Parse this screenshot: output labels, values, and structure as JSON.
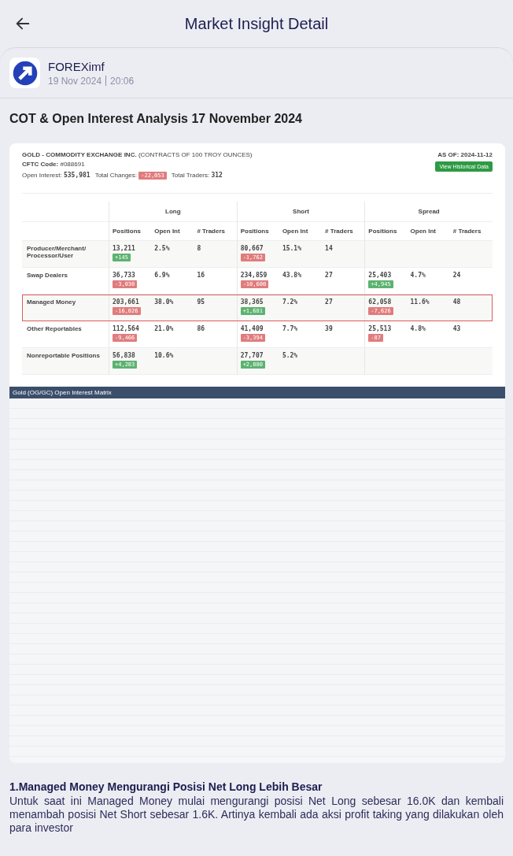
{
  "header": {
    "title": "Market Insight Detail"
  },
  "author": {
    "name": "FOREXimf",
    "date": "19 Nov 2024",
    "time": "20:06"
  },
  "article_title": "COT & Open Interest Analysis 17 November 2024",
  "cot": {
    "title": "GOLD - COMMODITY EXCHANGE INC.",
    "subtitle": "(CONTRACTS OF 100 TROY OUNCES)",
    "cftc_label": "CFTC Code:",
    "cftc_code": "#088691",
    "open_interest_label": "Open Interest:",
    "open_interest": "535,981",
    "total_changes_label": "Total Changes:",
    "total_changes": {
      "value": "-22,053",
      "negative": true
    },
    "total_traders_label": "Total Traders:",
    "total_traders": "312",
    "as_of": "AS OF: 2024-11-12",
    "button": "View Historical Data",
    "groups": [
      "Long",
      "Short",
      "Spread"
    ],
    "columns": [
      "Positions",
      "Open Int",
      "# Traders",
      "Positions",
      "Open Int",
      "# Traders",
      "Positions",
      "Open Int",
      "# Traders"
    ],
    "rows": [
      {
        "label": "Producer/Merchant/ Processor/User",
        "highlighted": false,
        "cells": [
          {
            "value": "13,211",
            "change": {
              "value": "+145",
              "negative": false
            }
          },
          {
            "value": "2.5%"
          },
          {
            "value": "8"
          },
          {
            "value": "80,667",
            "change": {
              "value": "-1,762",
              "negative": true
            }
          },
          {
            "value": "15.1%"
          },
          {
            "value": "14"
          }
        ]
      },
      {
        "label": "Swap Dealers",
        "highlighted": false,
        "cells": [
          {
            "value": "36,733",
            "change": {
              "value": "-3,030",
              "negative": true
            }
          },
          {
            "value": "6.9%"
          },
          {
            "value": "16"
          },
          {
            "value": "234,859",
            "change": {
              "value": "-10,600",
              "negative": true
            }
          },
          {
            "value": "43.8%"
          },
          {
            "value": "27"
          },
          {
            "value": "25,403",
            "change": {
              "value": "+4,945",
              "negative": false
            }
          },
          {
            "value": "4.7%"
          },
          {
            "value": "24"
          }
        ]
      },
      {
        "label": "Managed Money",
        "highlighted": true,
        "cells": [
          {
            "value": "203,661",
            "change": {
              "value": "-16,026",
              "negative": true
            }
          },
          {
            "value": "38.0%"
          },
          {
            "value": "95"
          },
          {
            "value": "38,365",
            "change": {
              "value": "+1,681",
              "negative": false
            }
          },
          {
            "value": "7.2%"
          },
          {
            "value": "27"
          },
          {
            "value": "62,058",
            "change": {
              "value": "-7,626",
              "negative": true
            }
          },
          {
            "value": "11.6%"
          },
          {
            "value": "48"
          }
        ]
      },
      {
        "label": "Other Reportables",
        "highlighted": false,
        "cells": [
          {
            "value": "112,564",
            "change": {
              "value": "-9,466",
              "negative": true
            }
          },
          {
            "value": "21.0%"
          },
          {
            "value": "86"
          },
          {
            "value": "41,409",
            "change": {
              "value": "-3,394",
              "negative": true
            }
          },
          {
            "value": "7.7%"
          },
          {
            "value": "39"
          },
          {
            "value": "25,513",
            "change": {
              "value": "-87",
              "negative": true
            }
          },
          {
            "value": "4.8%"
          },
          {
            "value": "43"
          }
        ]
      },
      {
        "label": "Nonreportable Positions",
        "highlighted": false,
        "cells": [
          {
            "value": "56,838",
            "change": {
              "value": "+4,283",
              "negative": false
            }
          },
          {
            "value": "10.6%"
          },
          {},
          {
            "value": "27,707",
            "change": {
              "value": "+2,880",
              "negative": false
            }
          },
          {
            "value": "5.2%"
          }
        ]
      }
    ]
  },
  "matrix": {
    "title": "Gold (OG/GC) Open Interest Matrix"
  },
  "section": {
    "heading": "1.Managed Money Mengurangi Posisi Net Long Lebih Besar",
    "body": "Untuk saat ini Managed Money mulai mengurangi posisi Net Long sebesar 16.0K dan kembali menambah posisi Net Short sebesar 1.6K. Artinya kembali ada aksi profit taking yang dilakukan oleh para investor"
  }
}
